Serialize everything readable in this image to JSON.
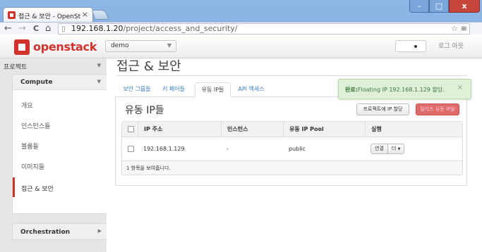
{
  "browser": {
    "tab_title": "접근 & 보안 - OpenStack",
    "tab_close": "×",
    "back": "←",
    "forward": "→",
    "reload": "C",
    "home": "⌂",
    "url_host": "192.168.1.20",
    "url_path": "/project/access_and_security/",
    "star": "☆",
    "menu": "≡",
    "min": "–",
    "max": "□",
    "close": "x"
  },
  "header": {
    "logo_text": "openstack",
    "project_select": "demo",
    "signout": "로그 아웃"
  },
  "sidebar": {
    "project_label": "프로젝트",
    "compute_label": "Compute",
    "items": [
      {
        "label": "개요"
      },
      {
        "label": "인스턴스들"
      },
      {
        "label": "볼륨들"
      },
      {
        "label": "이미지들"
      },
      {
        "label": "접근 & 보안",
        "active": true
      }
    ],
    "orchestration_label": "Orchestration"
  },
  "main": {
    "title": "접근 & 보안",
    "tabs": [
      {
        "label": "보안 그룹들"
      },
      {
        "label": "키 페어들"
      },
      {
        "label": "유동 IP들",
        "active": true
      },
      {
        "label": "API 엑세스"
      }
    ],
    "section_title": "유동 IP들",
    "allocate_button": "프로젝트에 IP 할당",
    "release_button": "릴리즈 유동 IP들",
    "table": {
      "headers": [
        "IP 주소",
        "인스턴스",
        "유동 IP Pool",
        "실행"
      ],
      "rows": [
        {
          "ip": "192.168.1.129",
          "instance": "-",
          "pool": "public",
          "action": "연결",
          "more": "더"
        }
      ],
      "footer": "1 항목을 보여줍니다."
    }
  },
  "alert": {
    "strong": "완료:",
    "message": "Floating IP 192.168.1.129 할당.",
    "close": "×"
  }
}
